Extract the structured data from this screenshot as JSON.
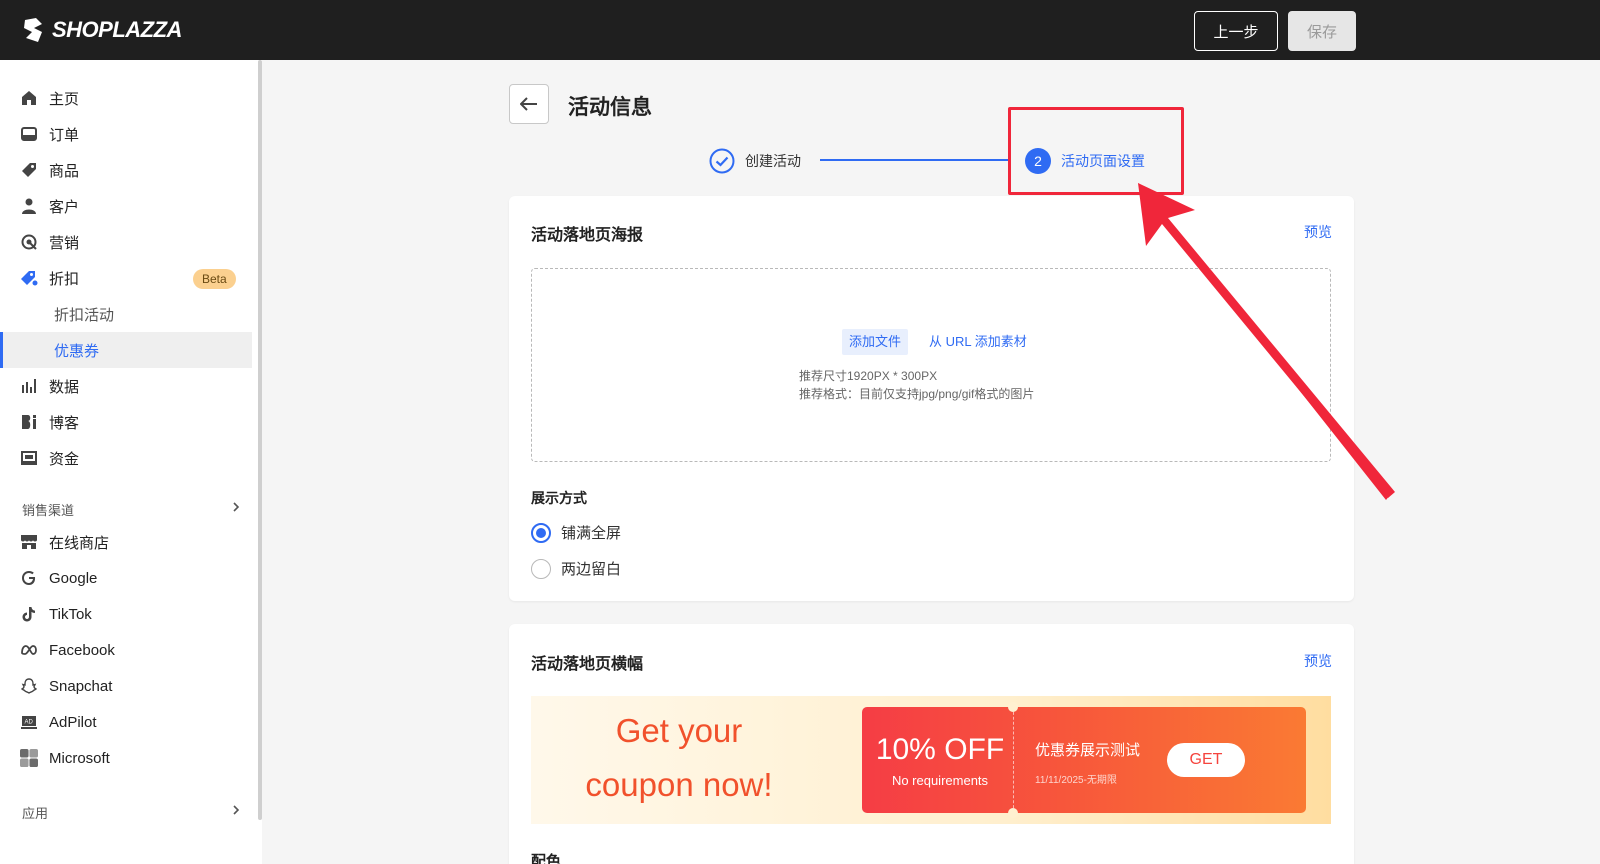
{
  "header": {
    "logo_text": "SHOPLAZZA",
    "prev_label": "上一步",
    "save_label": "保存"
  },
  "sidebar": {
    "items": [
      {
        "label": "主页",
        "icon": "home-icon"
      },
      {
        "label": "订单",
        "icon": "inbox-icon"
      },
      {
        "label": "商品",
        "icon": "tag-icon"
      },
      {
        "label": "客户",
        "icon": "person-icon"
      },
      {
        "label": "营销",
        "icon": "target-icon"
      },
      {
        "label": "折扣",
        "icon": "discount-tag-icon",
        "badge": "Beta"
      }
    ],
    "sub_items": [
      {
        "label": "折扣活动"
      },
      {
        "label": "优惠券",
        "active": true
      }
    ],
    "items2": [
      {
        "label": "数据",
        "icon": "bar-chart-icon"
      },
      {
        "label": "博客",
        "icon": "blog-icon"
      },
      {
        "label": "资金",
        "icon": "wallet-icon"
      }
    ],
    "channels_title": "销售渠道",
    "channels": [
      {
        "label": "在线商店",
        "icon": "store-icon"
      },
      {
        "label": "Google",
        "icon": "google-icon"
      },
      {
        "label": "TikTok",
        "icon": "tiktok-icon"
      },
      {
        "label": "Facebook",
        "icon": "meta-icon"
      },
      {
        "label": "Snapchat",
        "icon": "snapchat-icon"
      },
      {
        "label": "AdPilot",
        "icon": "adpilot-icon"
      },
      {
        "label": "Microsoft",
        "icon": "microsoft-icon"
      }
    ],
    "apps_title": "应用"
  },
  "page": {
    "title": "活动信息",
    "steps": [
      {
        "label": "创建活动",
        "state": "done"
      },
      {
        "number": "2",
        "label": "活动页面设置",
        "state": "current"
      }
    ]
  },
  "poster_card": {
    "title": "活动落地页海报",
    "preview": "预览",
    "add_file": "添加文件",
    "add_url": "从 URL 添加素材",
    "hint_size": "推荐尺寸1920PX * 300PX",
    "hint_format": "推荐格式：目前仅支持jpg/png/gif格式的图片",
    "display_label": "展示方式",
    "options": [
      {
        "label": "铺满全屏",
        "checked": true
      },
      {
        "label": "两边留白",
        "checked": false
      }
    ]
  },
  "banner_card": {
    "title": "活动落地页横幅",
    "preview": "预览",
    "banner_line1": "Get your",
    "banner_line2": "coupon now!",
    "coupon_off": "10% OFF",
    "coupon_req": "No requirements",
    "coupon_title": "优惠券展示测试",
    "coupon_date": "11/11/2025-无期限",
    "get_label": "GET",
    "color_label": "配色"
  },
  "colors": {
    "accent": "#2f6bf3",
    "highlight": "#f0263a",
    "topbar": "#1f1f1f"
  }
}
